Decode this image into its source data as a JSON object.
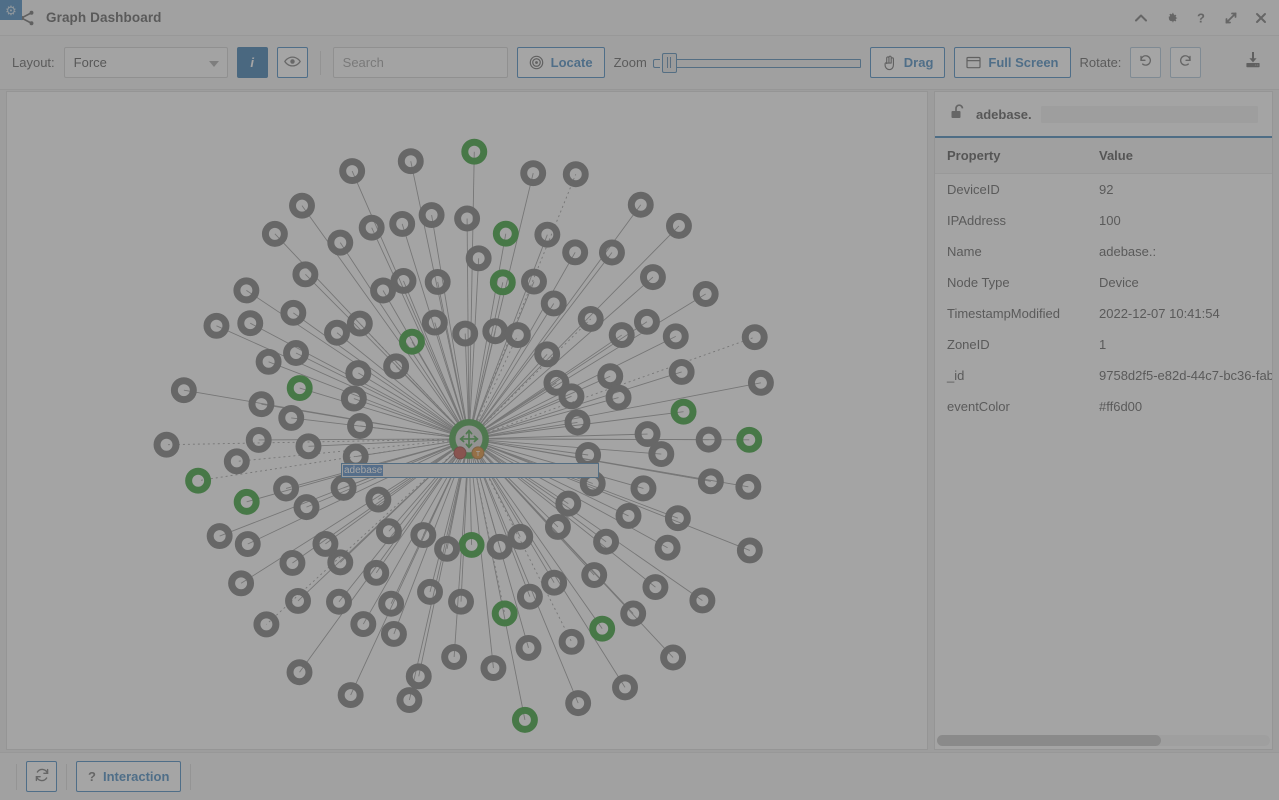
{
  "window": {
    "title": "Graph Dashboard",
    "app_icon": "gear-icon",
    "title_icon": "share-nodes-icon",
    "controls": [
      {
        "name": "collapse",
        "icon": "chevron-up-icon",
        "glyph": "ⱏ"
      },
      {
        "name": "settings",
        "icon": "gear-icon",
        "glyph": "⚙"
      },
      {
        "name": "help",
        "icon": "question-mark-icon",
        "glyph": "?"
      },
      {
        "name": "expand",
        "icon": "expand-arrows-icon",
        "glyph": "↗"
      },
      {
        "name": "close",
        "icon": "close-icon",
        "glyph": "✕"
      }
    ]
  },
  "toolbar": {
    "layout_label": "Layout:",
    "layout_value": "Force",
    "layout_options": [
      "Force"
    ],
    "info_button_label": "i",
    "eye_button_icon": "eye-icon",
    "search_placeholder": "Search",
    "search_value": "",
    "locate_label": "Locate",
    "locate_icon": "target-icon",
    "zoom_label": "Zoom",
    "zoom_value": 8,
    "zoom_min": 0,
    "zoom_max": 100,
    "drag_label": "Drag",
    "drag_icon": "hand-pointer-icon",
    "fullscreen_label": "Full Screen",
    "fullscreen_icon": "window-maximize-icon",
    "rotate_label": "Rotate:",
    "rotate_ccw_icon": "rotate-left-icon",
    "rotate_cw_icon": "rotate-right-icon",
    "download_icon": "download-icon"
  },
  "graph": {
    "center_node": {
      "label": "adebase",
      "icon": "move-arrows-icon",
      "ring_color": "#1e8a1e",
      "badge_red": "#b52a20",
      "badge_orange": "#d4730a"
    },
    "editor": {
      "value": "adebase",
      "selected_text": "adebase"
    },
    "node_default_color": "#5c5c5c",
    "node_highlight_color": "#0a8a0a",
    "edge_color": "#6f6f6f"
  },
  "properties": {
    "panel_title": "adebase.",
    "lock_icon": "unlock-icon",
    "columns": [
      "Property",
      "Value"
    ],
    "rows": [
      {
        "property": "DeviceID",
        "value": "92",
        "blurred": false
      },
      {
        "property": "IPAddress",
        "value": "100",
        "blurred": false
      },
      {
        "property": "Name",
        "value": "adebase.:",
        "blurred": false
      },
      {
        "property": "Node Type",
        "value": "Device",
        "blurred": false
      },
      {
        "property": "TimestampModified",
        "value": "2022-12-07 10:41:54",
        "blurred": false
      },
      {
        "property": "ZoneID",
        "value": "1",
        "blurred": false
      },
      {
        "property": "_id",
        "value": "9758d2f5-e82d-44c7-bc36-fab",
        "blurred": false
      },
      {
        "property": "eventColor",
        "value": "#ff6d00",
        "blurred": false
      }
    ]
  },
  "bottombar": {
    "refresh_icon": "refresh-icon",
    "interaction_label": "Interaction",
    "interaction_icon": "question-mark-icon"
  },
  "colors": {
    "accent": "#1f6fb2",
    "accent_dark": "#12609e",
    "node_green": "#0a8a0a",
    "event_color": "#ff6d00"
  }
}
